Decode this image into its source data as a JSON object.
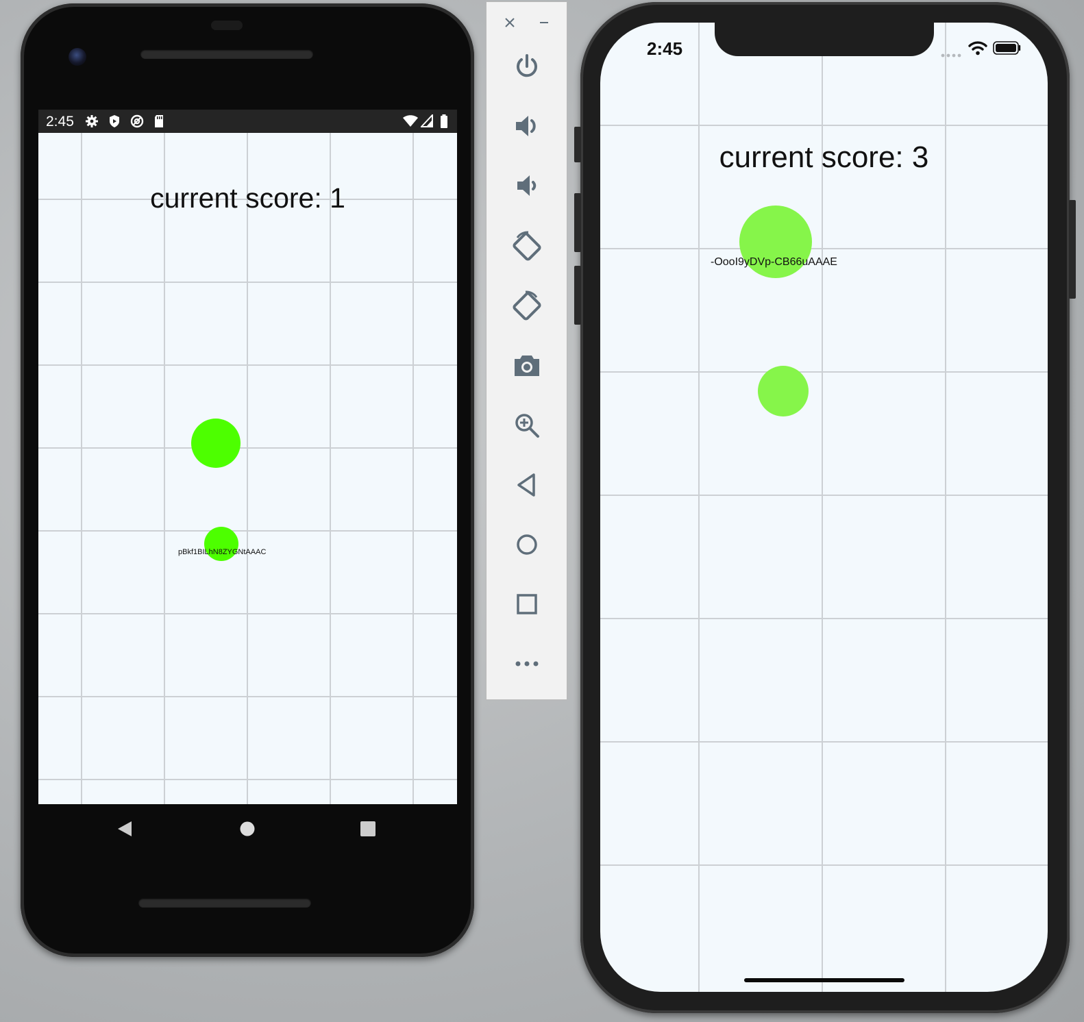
{
  "android": {
    "status_time": "2:45",
    "status_icons": [
      "gear-icon",
      "shield-icon",
      "at-icon",
      "sd-card-icon",
      "wifi-icon",
      "signal-icon",
      "battery-icon"
    ],
    "score_text": "current score: 1",
    "player_id": "pBkf1BILhN8ZYGNtAAAC",
    "nav_buttons": [
      "back-icon",
      "home-icon",
      "recents-icon"
    ],
    "dot_color_large": "#4dff00",
    "dot_color_small": "#4dff00"
  },
  "toolbar": {
    "buttons": [
      "close-icon",
      "minimize-icon",
      "power-icon",
      "volume-up-icon",
      "volume-down-icon",
      "rotate-left-icon",
      "rotate-right-icon",
      "camera-icon",
      "zoom-icon",
      "back-icon",
      "home-icon",
      "overview-icon",
      "more-icon"
    ]
  },
  "ios": {
    "status_time": "2:45",
    "status_icons": [
      "signal-dots-icon",
      "wifi-icon",
      "battery-icon"
    ],
    "score_text": "current score: 3",
    "player_id": "-OooI9yDVp-CB66uAAAE",
    "dot_color": "#86f54a"
  }
}
